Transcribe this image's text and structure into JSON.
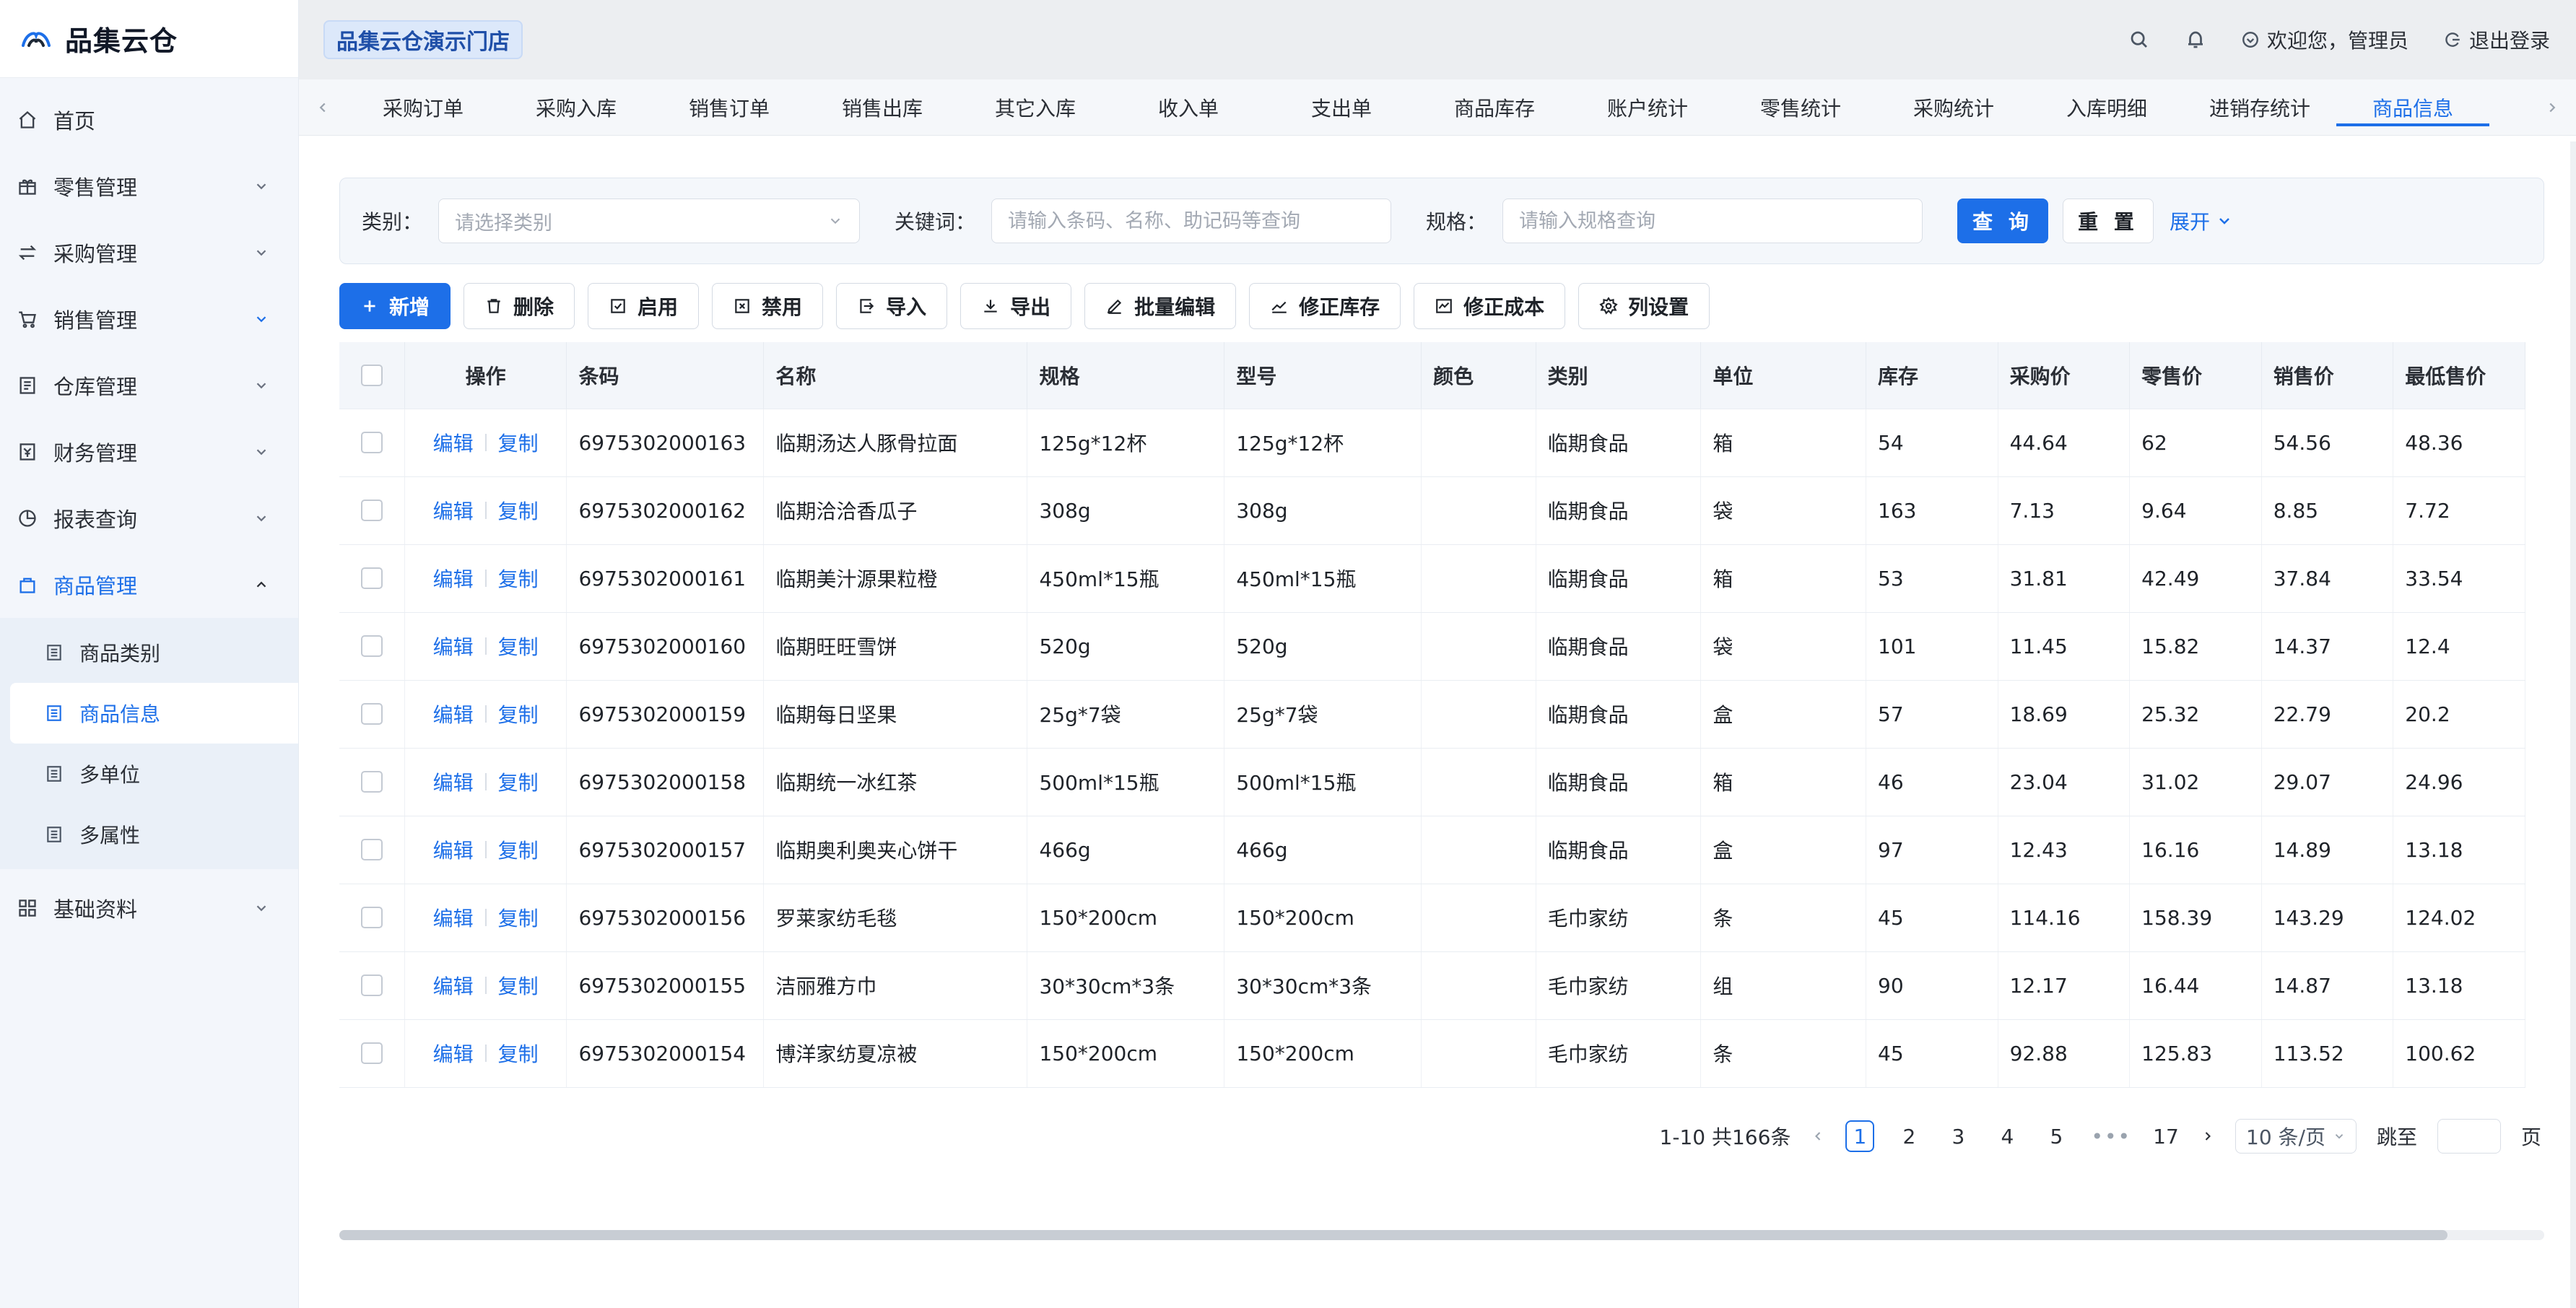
{
  "app": {
    "brand": "品集云仓",
    "store": "品集云仓演示门店",
    "welcome": "欢迎您，管理员",
    "logout": "退出登录"
  },
  "sidebar": {
    "items": [
      {
        "label": "首页",
        "icon": "home-icon"
      },
      {
        "label": "零售管理",
        "icon": "gift-icon"
      },
      {
        "label": "采购管理",
        "icon": "swap-icon"
      },
      {
        "label": "销售管理",
        "icon": "cart-icon"
      },
      {
        "label": "仓库管理",
        "icon": "warehouse-icon"
      },
      {
        "label": "财务管理",
        "icon": "wallet-icon"
      },
      {
        "label": "报表查询",
        "icon": "pie-chart-icon"
      },
      {
        "label": "商品管理",
        "icon": "bag-icon"
      }
    ],
    "product_sub": [
      {
        "label": "商品类别"
      },
      {
        "label": "商品信息"
      },
      {
        "label": "多单位"
      },
      {
        "label": "多属性"
      }
    ],
    "base": {
      "label": "基础资料",
      "icon": "grid-icon"
    }
  },
  "tabs": [
    "采购订单",
    "采购入库",
    "销售订单",
    "销售出库",
    "其它入库",
    "收入单",
    "支出单",
    "商品库存",
    "账户统计",
    "零售统计",
    "采购统计",
    "入库明细",
    "进销存统计",
    "商品信息"
  ],
  "filter": {
    "category_label": "类别：",
    "category_placeholder": "请选择类别",
    "keyword_label": "关键词：",
    "keyword_placeholder": "请输入条码、名称、助记码等查询",
    "spec_label": "规格：",
    "spec_placeholder": "请输入规格查询",
    "query": "查 询",
    "reset": "重 置",
    "expand": "展开"
  },
  "toolbar": {
    "add": "新增",
    "delete": "删除",
    "enable": "启用",
    "disable": "禁用",
    "import": "导入",
    "export": "导出",
    "batch_edit": "批量编辑",
    "fix_stock": "修正库存",
    "fix_cost": "修正成本",
    "columns": "列设置"
  },
  "table": {
    "headers": [
      "操作",
      "条码",
      "名称",
      "规格",
      "型号",
      "颜色",
      "类别",
      "单位",
      "库存",
      "采购价",
      "零售价",
      "销售价",
      "最低售价"
    ],
    "edit": "编辑",
    "copy": "复制",
    "rows": [
      [
        "6975302000163",
        "临期汤达人豚骨拉面",
        "125g*12杯",
        "125g*12杯",
        "",
        "临期食品",
        "箱",
        "54",
        "44.64",
        "62",
        "54.56",
        "48.36"
      ],
      [
        "6975302000162",
        "临期洽洽香瓜子",
        "308g",
        "308g",
        "",
        "临期食品",
        "袋",
        "163",
        "7.13",
        "9.64",
        "8.85",
        "7.72"
      ],
      [
        "6975302000161",
        "临期美汁源果粒橙",
        "450ml*15瓶",
        "450ml*15瓶",
        "",
        "临期食品",
        "箱",
        "53",
        "31.81",
        "42.49",
        "37.84",
        "33.54"
      ],
      [
        "6975302000160",
        "临期旺旺雪饼",
        "520g",
        "520g",
        "",
        "临期食品",
        "袋",
        "101",
        "11.45",
        "15.82",
        "14.37",
        "12.4"
      ],
      [
        "6975302000159",
        "临期每日坚果",
        "25g*7袋",
        "25g*7袋",
        "",
        "临期食品",
        "盒",
        "57",
        "18.69",
        "25.32",
        "22.79",
        "20.2"
      ],
      [
        "6975302000158",
        "临期统一冰红茶",
        "500ml*15瓶",
        "500ml*15瓶",
        "",
        "临期食品",
        "箱",
        "46",
        "23.04",
        "31.02",
        "29.07",
        "24.96"
      ],
      [
        "6975302000157",
        "临期奥利奥夹心饼干",
        "466g",
        "466g",
        "",
        "临期食品",
        "盒",
        "97",
        "12.43",
        "16.16",
        "14.89",
        "13.18"
      ],
      [
        "6975302000156",
        "罗莱家纺毛毯",
        "150*200cm",
        "150*200cm",
        "",
        "毛巾家纺",
        "条",
        "45",
        "114.16",
        "158.39",
        "143.29",
        "124.02"
      ],
      [
        "6975302000155",
        "洁丽雅方巾",
        "30*30cm*3条",
        "30*30cm*3条",
        "",
        "毛巾家纺",
        "组",
        "90",
        "12.17",
        "16.44",
        "14.87",
        "13.18"
      ],
      [
        "6975302000154",
        "博洋家纺夏凉被",
        "150*200cm",
        "150*200cm",
        "",
        "毛巾家纺",
        "条",
        "45",
        "92.88",
        "125.83",
        "113.52",
        "100.62"
      ]
    ]
  },
  "pager": {
    "summary": "1-10 共166条",
    "pages": [
      "1",
      "2",
      "3",
      "4",
      "5"
    ],
    "dots": "•••",
    "last": "17",
    "size": "10 条/页",
    "jump_label": "跳至",
    "page_unit": "页"
  }
}
